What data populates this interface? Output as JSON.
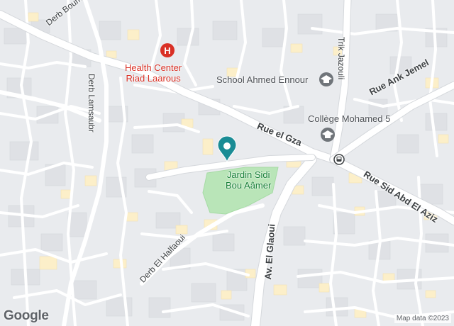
{
  "map": {
    "brand": "Google",
    "attribution": "Map data ©2023",
    "colors": {
      "background": "#f1f3f4",
      "road": "#ffffff",
      "block": "#e8eaed",
      "building": "#fdf3d5",
      "park": "#b9e5b8",
      "poi_red": "#d93025",
      "poi_gray": "#70757a",
      "pin": "#1a8c95"
    },
    "streets": {
      "derb_boumba": "Derb Boumba",
      "derb_lamsaubr": "Derb Lamsaubr",
      "trik_jazouli": "Trik Jazouli",
      "rue_ank_jemel": "Rue Ank Jemel",
      "rue_el_gza": "Rue el Gza",
      "rue_sid_abd_el_aziz": "Rue Sid Abd El Aziz",
      "av_el_glaoui": "Av. El Glaoui",
      "derb_el_halfaoui": "Derb El Halfaoui"
    },
    "pois": {
      "health_center": {
        "name_line1": "Health Center",
        "name_line2": "Riad Laarous",
        "icon": "hospital-icon"
      },
      "school": {
        "name": "School Ahmed Ennour",
        "icon": "school-icon"
      },
      "college": {
        "name": "Collège Mohamed 5",
        "icon": "school-icon"
      },
      "park": {
        "name_line1": "Jardin Sidi",
        "name_line2": "Bou Aâmer"
      },
      "bus_stop": {
        "icon": "bus-stop-icon"
      },
      "location_pin": {
        "icon": "location-pin-icon"
      }
    }
  }
}
